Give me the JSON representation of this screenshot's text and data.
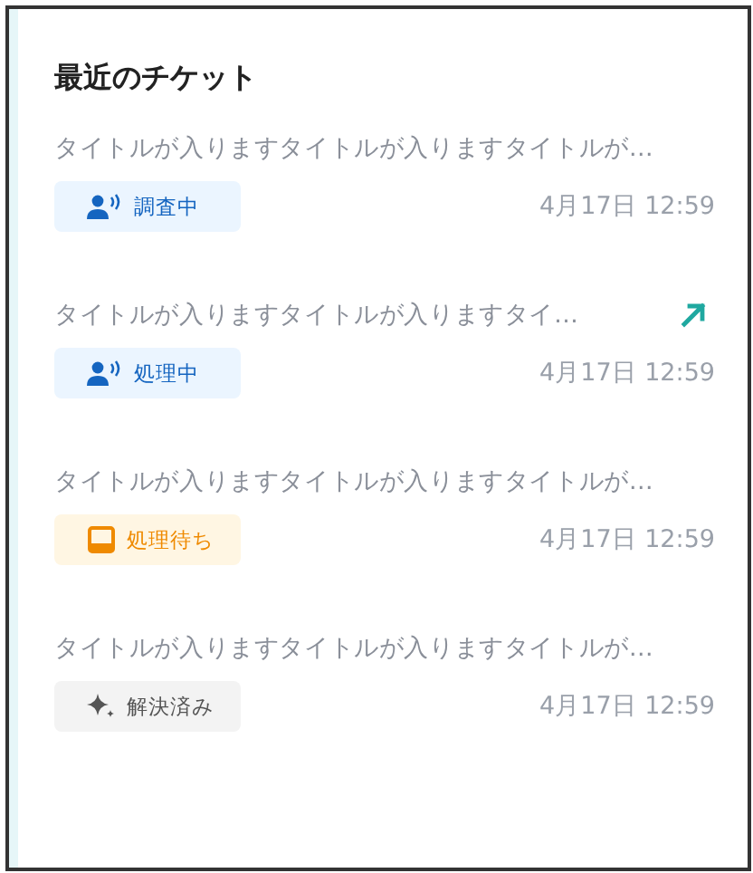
{
  "card": {
    "title": "最近のチケット"
  },
  "tickets": [
    {
      "title": "タイトルが入りますタイトルが入りますタイトルが…",
      "status": {
        "kind": "investigating",
        "label": "調査中"
      },
      "date": "4月17日 12:59",
      "hovered": false
    },
    {
      "title": "タイトルが入りますタイトルが入りますタイ…",
      "status": {
        "kind": "processing",
        "label": "処理中"
      },
      "date": "4月17日 12:59",
      "hovered": true
    },
    {
      "title": "タイトルが入りますタイトルが入りますタイトルが…",
      "status": {
        "kind": "waiting",
        "label": "処理待ち"
      },
      "date": "4月17日 12:59",
      "hovered": false
    },
    {
      "title": "タイトルが入りますタイトルが入りますタイトルが…",
      "status": {
        "kind": "resolved",
        "label": "解決済み"
      },
      "date": "4月17日 12:59",
      "hovered": false
    }
  ]
}
